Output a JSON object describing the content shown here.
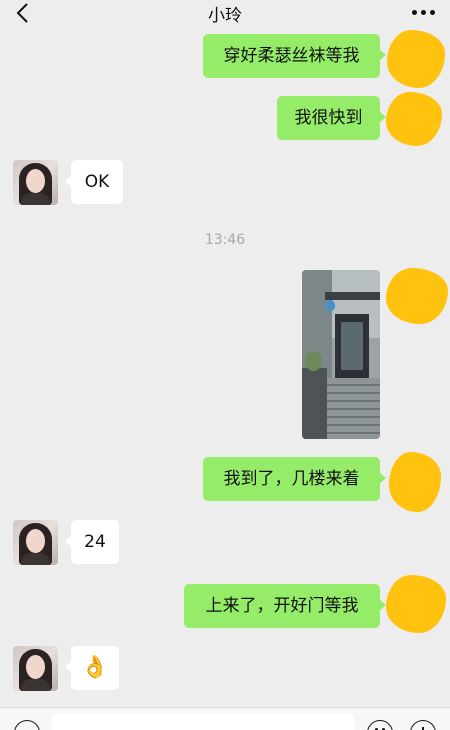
{
  "header": {
    "title": "小玲",
    "back_icon": "chevron-left-icon",
    "more_icon": "more-dots-icon"
  },
  "messages": [
    {
      "sender": "me",
      "type": "text",
      "text": "穿好柔瑟丝袜等我"
    },
    {
      "sender": "me",
      "type": "text",
      "text": "我很快到"
    },
    {
      "sender": "other",
      "type": "text",
      "text": "OK"
    },
    {
      "sender": "me",
      "type": "image",
      "description": ""
    },
    {
      "sender": "me",
      "type": "text",
      "text": "我到了，几楼来着"
    },
    {
      "sender": "other",
      "type": "text",
      "text": "24"
    },
    {
      "sender": "me",
      "type": "text",
      "text": "上来了，开好门等我"
    },
    {
      "sender": "other",
      "type": "emoji",
      "text": "👌"
    }
  ],
  "timestamp": "13:46",
  "input_bar": {
    "voice_icon": "voice-icon",
    "emoji_icon": "emoji-face-icon",
    "plus_icon": "plus-circle-icon",
    "input_value": ""
  },
  "colors": {
    "background": "#ededed",
    "my_bubble": "#95ec69",
    "their_bubble": "#ffffff",
    "redaction": "#ffc20e"
  }
}
